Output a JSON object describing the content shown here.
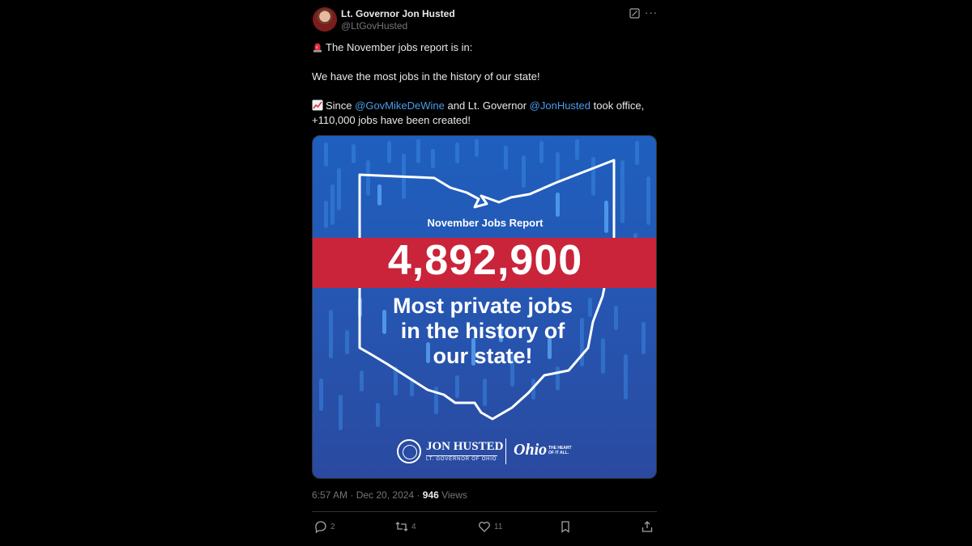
{
  "author": {
    "display_name": "Lt. Governor Jon Husted",
    "handle": "@LtGovHusted"
  },
  "icons": {
    "avatar": "profile-photo",
    "grok": "grok-icon",
    "more": "more-icon",
    "siren": "police-light-emoji",
    "chart": "chart-increasing-emoji",
    "reply": "reply-icon",
    "repost": "repost-icon",
    "like": "like-icon",
    "bookmark": "bookmark-icon",
    "share": "share-icon"
  },
  "tweet": {
    "line1": "The November jobs report is in:",
    "line2": "We have the most jobs in the history of our state!",
    "line3_prefix": "Since ",
    "mention1": "@GovMikeDeWine",
    "line3_mid": " and Lt. Governor ",
    "mention2": "@JonHusted",
    "line3_suffix": " took office,",
    "line4": "+110,000 jobs have been created!"
  },
  "media": {
    "report_title": "November Jobs Report",
    "big_number": "4,892,900",
    "headline_1": "Most private jobs",
    "headline_2": "in the history of",
    "headline_3": "our state!",
    "logo_name": "JON HUSTED",
    "logo_sub": "LT. GOVERNOR OF OHIO",
    "ohio_word": "Ohio",
    "ohio_tagline_1": "THE HEART",
    "ohio_tagline_2": "OF IT ALL."
  },
  "meta": {
    "time": "6:57 AM",
    "separator": " · ",
    "date": "Dec 20, 2024",
    "views_count": "946",
    "views_label": " Views"
  },
  "actions": {
    "replies": "2",
    "reposts": "4",
    "likes": "11"
  },
  "colors": {
    "background": "#000000",
    "mention": "#4a9ce8",
    "band_red": "#c9243a",
    "graphic_blue": "#2557b3"
  }
}
